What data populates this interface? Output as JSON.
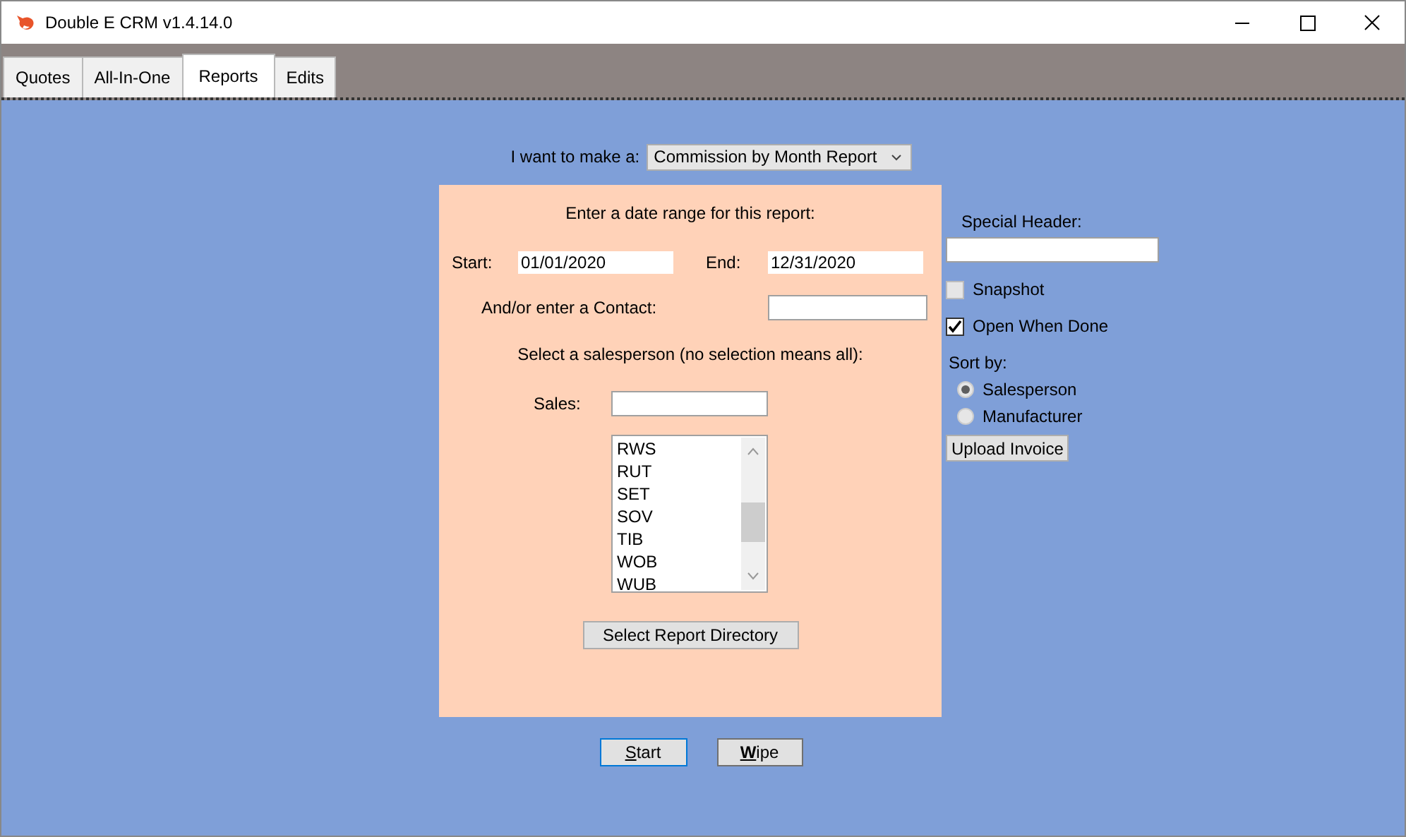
{
  "window": {
    "title": "Double E CRM v1.4.14.0"
  },
  "tabs": [
    {
      "label": "Quotes",
      "selected": false
    },
    {
      "label": "All-In-One",
      "selected": false
    },
    {
      "label": "Reports",
      "selected": true
    },
    {
      "label": "Edits",
      "selected": false
    }
  ],
  "report_type": {
    "label": "I want to make a:",
    "value": "Commission by Month Report"
  },
  "panel": {
    "heading": "Enter a date range for this report:",
    "start": {
      "label": "Start:",
      "value": "01/01/2020"
    },
    "end": {
      "label": "End:",
      "value": "12/31/2020"
    },
    "contact": {
      "label": "And/or enter a Contact:"
    },
    "salesperson_heading": "Select a salesperson (no selection means all):",
    "sales": {
      "label": "Sales:"
    },
    "sales_list": [
      "RWS",
      "RUT",
      "SET",
      "SOV",
      "TIB",
      "WOB",
      "WUB"
    ],
    "directory_button": "Select Report Directory"
  },
  "buttons": [
    {
      "label": "Start",
      "focused": true
    },
    {
      "label": "**W**ipe",
      "focused": false
    }
  ],
  "options": {
    "special_header": {
      "label": "Special Header:"
    },
    "checkboxes": [
      {
        "label": "Snapshot",
        "checked": false,
        "disabled": true
      },
      {
        "label": "Open When Done",
        "checked": true,
        "disabled": false
      }
    ],
    "sort_label": "Sort by:",
    "sort": [
      {
        "label": "Salesperson",
        "selected": true
      },
      {
        "label": "Manufacturer",
        "selected": false
      }
    ],
    "upload_button": "Upload Invoice"
  }
}
